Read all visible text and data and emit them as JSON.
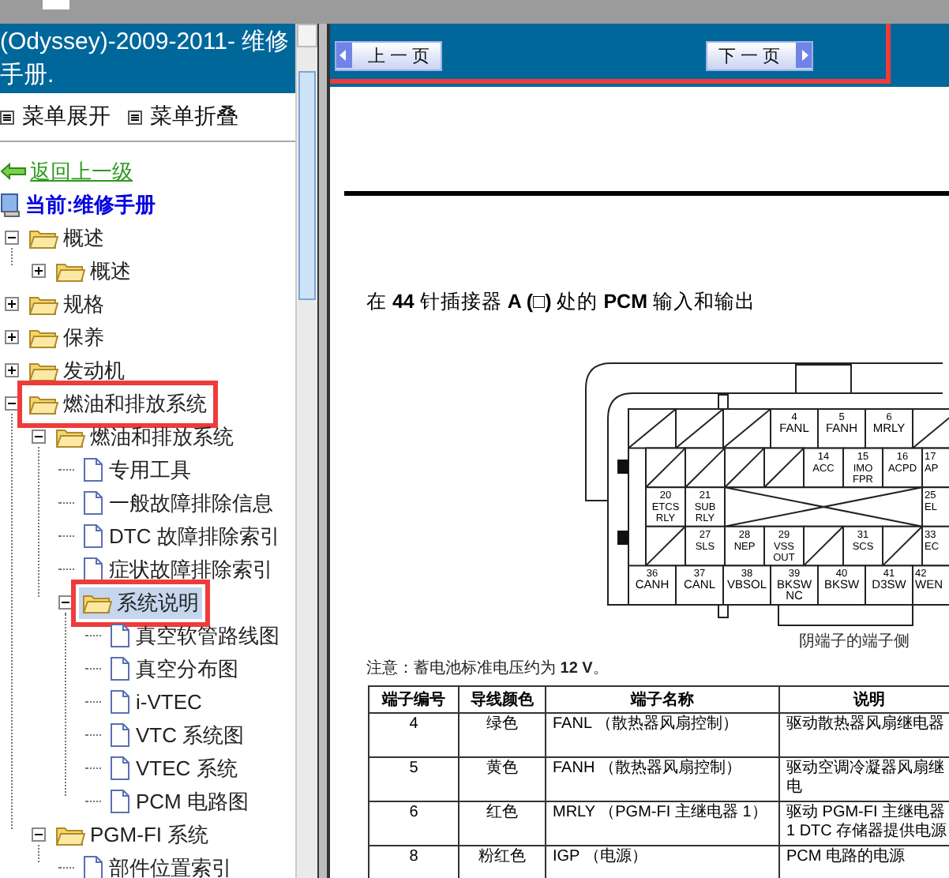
{
  "sidebar": {
    "title": "(Odyssey)-2009-2011- 维修手册.",
    "toolbar": [
      "菜单展开",
      "菜单折叠"
    ],
    "back_link": "返回上一级",
    "current": "当前:维修手册",
    "tree": [
      {
        "kind": "folder",
        "label": "概述",
        "expanded": true,
        "selected": false,
        "highlighted": false,
        "children": [
          {
            "kind": "folder",
            "label": "概述",
            "expanded": false,
            "selected": false,
            "highlighted": false
          }
        ]
      },
      {
        "kind": "folder",
        "label": "规格",
        "expanded": false,
        "selected": false,
        "highlighted": false
      },
      {
        "kind": "folder",
        "label": "保养",
        "expanded": false,
        "selected": false,
        "highlighted": false
      },
      {
        "kind": "folder",
        "label": "发动机",
        "expanded": false,
        "selected": false,
        "highlighted": false
      },
      {
        "kind": "folder",
        "label": "燃油和排放系统",
        "expanded": true,
        "selected": false,
        "highlighted": true,
        "children": [
          {
            "kind": "folder",
            "label": "燃油和排放系统",
            "expanded": true,
            "selected": false,
            "highlighted": false,
            "children": [
              {
                "kind": "page",
                "label": "专用工具",
                "selected": false,
                "highlighted": false
              },
              {
                "kind": "page",
                "label": "一般故障排除信息",
                "selected": false,
                "highlighted": false
              },
              {
                "kind": "page",
                "label": "DTC 故障排除索引",
                "selected": false,
                "highlighted": false
              },
              {
                "kind": "page",
                "label": "症状故障排除索引",
                "selected": false,
                "highlighted": false
              },
              {
                "kind": "folder",
                "label": "系统说明",
                "expanded": true,
                "selected": true,
                "highlighted": true,
                "children": [
                  {
                    "kind": "page",
                    "label": "真空软管路线图",
                    "selected": false,
                    "highlighted": false
                  },
                  {
                    "kind": "page",
                    "label": "真空分布图",
                    "selected": false,
                    "highlighted": false
                  },
                  {
                    "kind": "page",
                    "label": "i-VTEC",
                    "selected": false,
                    "highlighted": false
                  },
                  {
                    "kind": "page",
                    "label": "VTC 系统图",
                    "selected": false,
                    "highlighted": false
                  },
                  {
                    "kind": "page",
                    "label": "VTEC 系统",
                    "selected": false,
                    "highlighted": false
                  },
                  {
                    "kind": "page",
                    "label": "PCM 电路图",
                    "selected": false,
                    "highlighted": false
                  }
                ]
              }
            ]
          },
          {
            "kind": "folder",
            "label": "PGM-FI 系统",
            "expanded": true,
            "selected": false,
            "highlighted": false,
            "children": [
              {
                "kind": "page",
                "label": "部件位置索引",
                "selected": false,
                "highlighted": false
              }
            ]
          }
        ]
      }
    ]
  },
  "nav": {
    "highlighted": true,
    "buttons": [
      {
        "kind": "prev",
        "label": "上 一 页"
      },
      {
        "kind": "next",
        "label": "下 一 页"
      }
    ]
  },
  "document": {
    "heading": "在 **44** 针插接器 **A (□)** 处的 **PCM** 输入和输出",
    "connector": {
      "top_row": {
        "cells": [
          {
            "kind": "blank"
          },
          {
            "kind": "blank"
          },
          {
            "kind": "blank"
          },
          {
            "kind": "pin",
            "number": "4",
            "name": [
              "FANL"
            ]
          },
          {
            "kind": "pin",
            "number": "5",
            "name": [
              "FANH"
            ]
          },
          {
            "kind": "pin",
            "number": "6",
            "name": [
              "MRLY"
            ]
          },
          {
            "kind": "blank"
          }
        ]
      },
      "middle_rows": [
        {
          "cells": [
            {
              "kind": "blank"
            },
            {
              "kind": "blank"
            },
            {
              "kind": "blank"
            },
            {
              "kind": "blank"
            },
            {
              "kind": "pin",
              "number": "14",
              "name": [
                "ACC"
              ]
            },
            {
              "kind": "pin",
              "number": "15",
              "name": [
                "IMO",
                "FPR"
              ]
            },
            {
              "kind": "pin",
              "number": "16",
              "name": [
                "ACPD"
              ]
            },
            {
              "kind": "pin",
              "number": "17",
              "name": [
                "AP"
              ]
            }
          ]
        },
        {
          "cells": [
            {
              "kind": "pin",
              "number": "20",
              "name": [
                "ETCS",
                "RLY"
              ]
            },
            {
              "kind": "pin",
              "number": "21",
              "name": [
                "SUB",
                "RLY"
              ]
            },
            {
              "kind": "crossed"
            },
            {
              "kind": "covered"
            },
            {
              "kind": "covered"
            },
            {
              "kind": "covered"
            },
            {
              "kind": "covered"
            },
            {
              "kind": "pin",
              "number": "25",
              "name": [
                "EL"
              ]
            }
          ]
        },
        {
          "cells": [
            {
              "kind": "blank"
            },
            {
              "kind": "pin",
              "number": "27",
              "name": [
                "SLS"
              ]
            },
            {
              "kind": "pin",
              "number": "28",
              "name": [
                "NEP"
              ]
            },
            {
              "kind": "pin",
              "number": "29",
              "name": [
                "VSS",
                "OUT"
              ]
            },
            {
              "kind": "blank"
            },
            {
              "kind": "pin",
              "number": "31",
              "name": [
                "SCS"
              ]
            },
            {
              "kind": "blank"
            },
            {
              "kind": "pin",
              "number": "33",
              "name": [
                "EC"
              ]
            }
          ]
        }
      ],
      "bottom_row": {
        "cells": [
          {
            "kind": "pin",
            "number": "36",
            "name": [
              "CANH"
            ]
          },
          {
            "kind": "pin",
            "number": "37",
            "name": [
              "CANL"
            ]
          },
          {
            "kind": "pin",
            "number": "38",
            "name": [
              "VBSOL"
            ]
          },
          {
            "kind": "pin",
            "number": "39",
            "name": [
              "BKSW",
              "NC"
            ]
          },
          {
            "kind": "pin",
            "number": "40",
            "name": [
              "BKSW"
            ]
          },
          {
            "kind": "pin",
            "number": "41",
            "name": [
              "D3SW"
            ]
          },
          {
            "kind": "pin",
            "number": "42",
            "name": [
              "WEN"
            ]
          }
        ]
      }
    },
    "caption": "阴端子的端子侧",
    "note": "注意：蓄电池标准电压约为 **12 V**。",
    "table": {
      "columns": [
        "端子编号",
        "导线颜色",
        "端子名称",
        "说明"
      ],
      "rows": [
        [
          "4",
          "绿色",
          "FANL （散热器风扇控制）",
          "驱动散热器风扇继电器"
        ],
        [
          "5",
          "黄色",
          "FANH （散热器风扇控制）",
          "驱动空调冷凝器风扇继电"
        ],
        [
          "6",
          "红色",
          "MRLY （PGM-FI 主继电器 1）",
          "驱动 PGM-FI 主继电器 1 DTC 存储器提供电源"
        ],
        [
          "8",
          "粉红色",
          "IGP （电源）",
          "PCM 电路的电源"
        ]
      ]
    }
  }
}
